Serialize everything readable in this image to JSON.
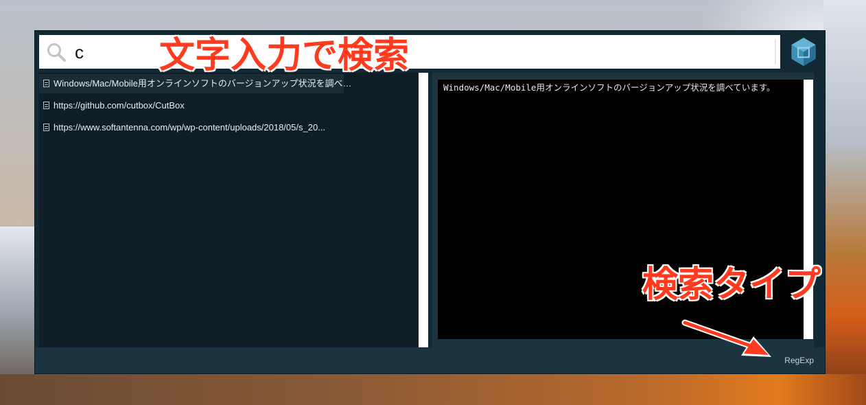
{
  "search": {
    "query": "c",
    "placeholder": ""
  },
  "results": [
    {
      "text": "Windows/Mac/Mobile用オンラインソフトのバージョンアップ状況を調べ…",
      "selected": true
    },
    {
      "text": "https://github.com/cutbox/CutBox",
      "selected": false
    },
    {
      "text": "https://www.softantenna.com/wp/wp-content/uploads/2018/05/s_20...",
      "selected": false
    }
  ],
  "preview": {
    "text": "Windows/Mac/Mobile用オンラインソフトのバージョンアップ状況を調べています。"
  },
  "status": {
    "search_type": "RegExp"
  },
  "annotations": {
    "search_label": "文字入力で検索",
    "type_label": "検索タイプ"
  },
  "colors": {
    "annotation": "#ff3b1f",
    "window_bg": "#122833",
    "logo": "#3d90b8"
  },
  "icons": {
    "search": "search-icon",
    "logo": "cutbox-logo-icon",
    "item": "document-icon"
  }
}
